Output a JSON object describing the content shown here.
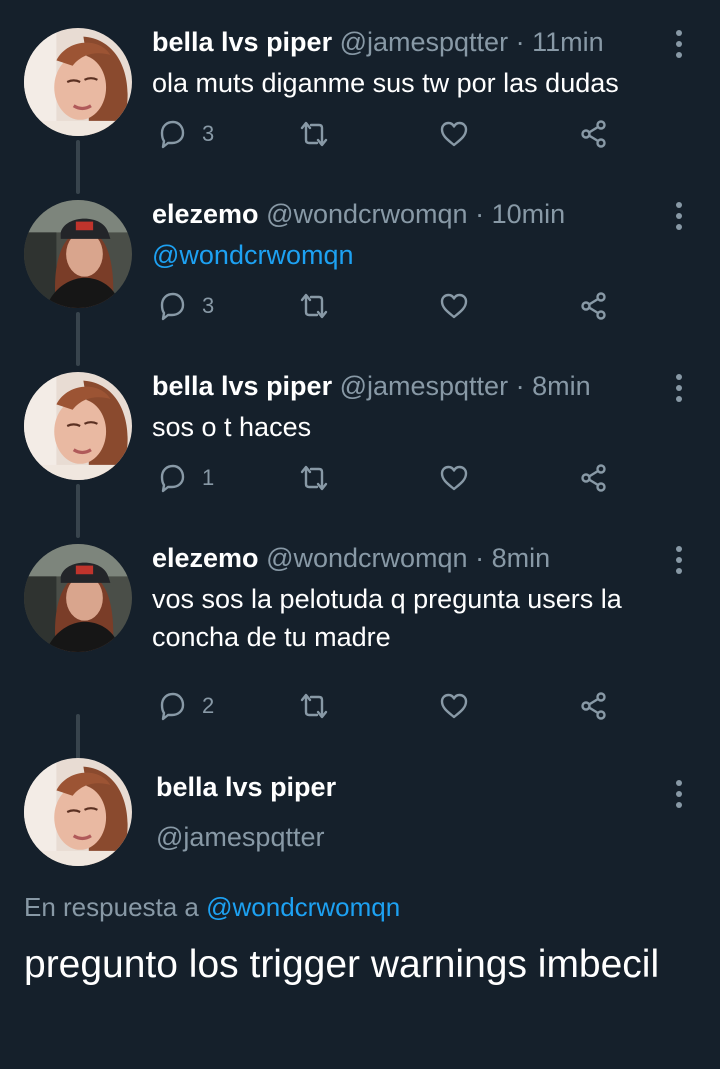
{
  "tweets": [
    {
      "name": "bella lvs piper",
      "handle": "@jamespqtter",
      "dot": "·",
      "time": "11min",
      "text": "ola muts diganme sus tw por las dudas",
      "text_is_mention": false,
      "reply_count": "3",
      "avatar": "bella"
    },
    {
      "name": "elezemo",
      "handle": "@wondcrwomqn",
      "dot": "·",
      "time": "10min",
      "text": "@wondcrwomqn",
      "text_is_mention": true,
      "reply_count": "3",
      "avatar": "elezemo"
    },
    {
      "name": "bella lvs piper",
      "handle": "@jamespqtter",
      "dot": "·",
      "time": "8min",
      "text": "sos o t haces",
      "text_is_mention": false,
      "reply_count": "1",
      "avatar": "bella"
    },
    {
      "name": "elezemo",
      "handle": "@wondcrwomqn",
      "dot": "·",
      "time": "8min",
      "text": "vos sos la pelotuda q pregunta users la concha de tu madre",
      "text_is_mention": false,
      "reply_count": "2",
      "avatar": "elezemo"
    }
  ],
  "focused": {
    "name": "bella lvs piper",
    "handle": "@jamespqtter",
    "reply_prefix": "En respuesta a",
    "reply_to": "@wondcrwomqn",
    "text": "pregunto los trigger warnings imbecil"
  },
  "colors": {
    "background": "#15202b",
    "secondary_text": "#8899a6",
    "link": "#1da1f2",
    "thread_line": "#38444d"
  },
  "icons": [
    "reply-icon",
    "retweet-icon",
    "like-icon",
    "share-icon",
    "more-options-icon"
  ]
}
